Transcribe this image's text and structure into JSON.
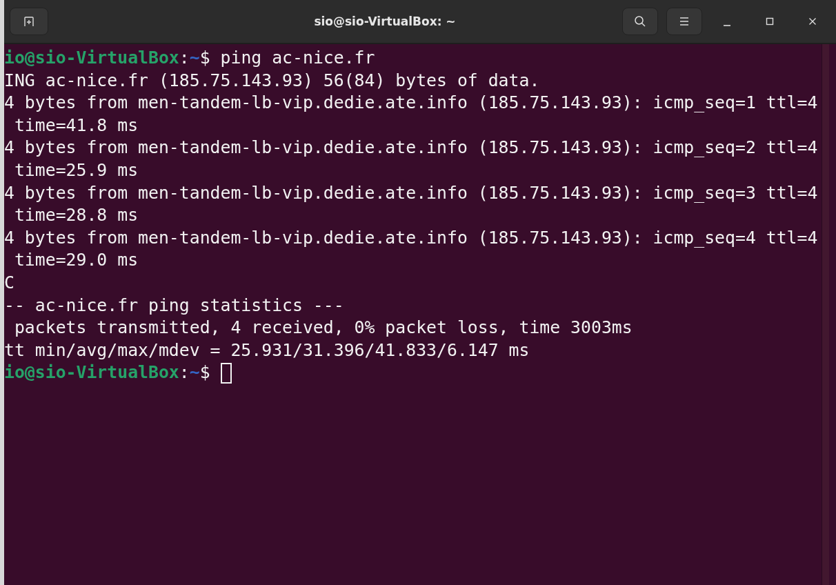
{
  "window": {
    "title": "sio@sio-VirtualBox: ~"
  },
  "terminal": {
    "lines": [
      {
        "kind": "prompt",
        "user": "io@sio-VirtualBox",
        "separator": ":",
        "path": "~",
        "symbol": "$",
        "command": " ping ac-nice.fr",
        "cursor": false
      },
      {
        "kind": "output",
        "text": "ING ac-nice.fr (185.75.143.93) 56(84) bytes of data."
      },
      {
        "kind": "output",
        "text": "4 bytes from men-tandem-lb-vip.dedie.ate.info (185.75.143.93): icmp_seq=1 ttl=4"
      },
      {
        "kind": "output",
        "text": " time=41.8 ms"
      },
      {
        "kind": "output",
        "text": "4 bytes from men-tandem-lb-vip.dedie.ate.info (185.75.143.93): icmp_seq=2 ttl=4"
      },
      {
        "kind": "output",
        "text": " time=25.9 ms"
      },
      {
        "kind": "output",
        "text": "4 bytes from men-tandem-lb-vip.dedie.ate.info (185.75.143.93): icmp_seq=3 ttl=4"
      },
      {
        "kind": "output",
        "text": " time=28.8 ms"
      },
      {
        "kind": "output",
        "text": "4 bytes from men-tandem-lb-vip.dedie.ate.info (185.75.143.93): icmp_seq=4 ttl=4"
      },
      {
        "kind": "output",
        "text": " time=29.0 ms"
      },
      {
        "kind": "output",
        "text": "C"
      },
      {
        "kind": "output",
        "text": "-- ac-nice.fr ping statistics ---"
      },
      {
        "kind": "output",
        "text": " packets transmitted, 4 received, 0% packet loss, time 3003ms"
      },
      {
        "kind": "output",
        "text": "tt min/avg/max/mdev = 25.931/31.396/41.833/6.147 ms"
      },
      {
        "kind": "prompt",
        "user": "io@sio-VirtualBox",
        "separator": ":",
        "path": "~",
        "symbol": "$",
        "cursor": true
      }
    ]
  }
}
